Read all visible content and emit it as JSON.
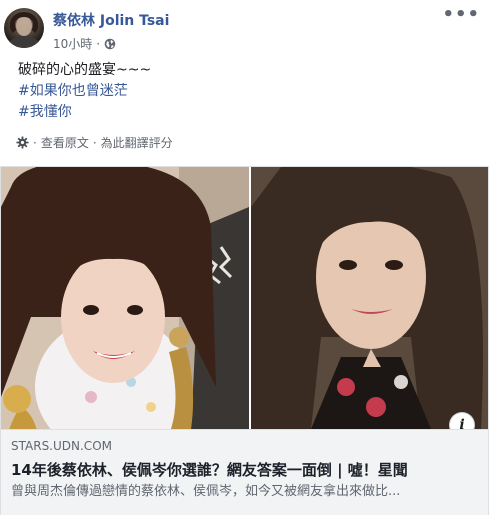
{
  "post": {
    "author": "蔡依林 Jolin Tsai",
    "time": "10小時",
    "separator": "·",
    "privacy_icon": "globe-icon",
    "more_icon": "more-options-icon",
    "text_lines": [
      "破碎的心的盛宴~~~"
    ],
    "hashtags": [
      "#如果你也曾迷茫",
      "#我懂你"
    ],
    "translate": {
      "gear_icon": "gear-icon",
      "see_original": "查看原文",
      "separator": "·",
      "rate_translation": "為此翻譯評分"
    }
  },
  "link_preview": {
    "domain": "STARS.UDN.COM",
    "title": "14年後蔡依林、侯佩岑你選誰？網友答案一面倒 | 噓！星聞",
    "description": "曾與周杰倫傳過戀情的蔡依林、侯佩岑，如今又被網友拿出來做比...",
    "info_icon": "i"
  },
  "colors": {
    "link_blue": "#385898",
    "meta_gray": "#616770",
    "caption_bg": "#f2f3f5"
  }
}
